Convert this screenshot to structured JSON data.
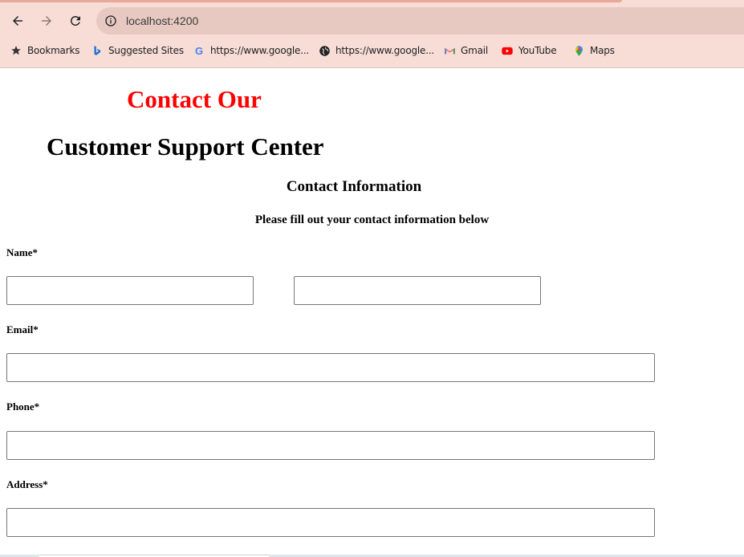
{
  "browser": {
    "url": "localhost:4200",
    "bookmarks": [
      {
        "label": "Bookmarks",
        "icon": "star-icon"
      },
      {
        "label": "Suggested Sites",
        "icon": "bing-icon"
      },
      {
        "label": "https://www.google...",
        "icon": "google-icon"
      },
      {
        "label": "https://www.google...",
        "icon": "globe-icon"
      },
      {
        "label": "Gmail",
        "icon": "gmail-icon"
      },
      {
        "label": "YouTube",
        "icon": "youtube-icon"
      },
      {
        "label": "Maps",
        "icon": "maps-icon"
      }
    ]
  },
  "page": {
    "title_line1": "Contact Our",
    "title_line2": "Customer Support Center",
    "section_heading": "Contact Information",
    "section_subheading": "Please fill out your contact information below",
    "title_color": "#ff0000"
  },
  "form": {
    "name_label": "Name*",
    "first_name_value": "",
    "last_name_value": "",
    "email_label": "Email*",
    "email_value": "",
    "phone_label": "Phone*",
    "phone_value": "",
    "address_label": "Address*",
    "address_value": ""
  }
}
